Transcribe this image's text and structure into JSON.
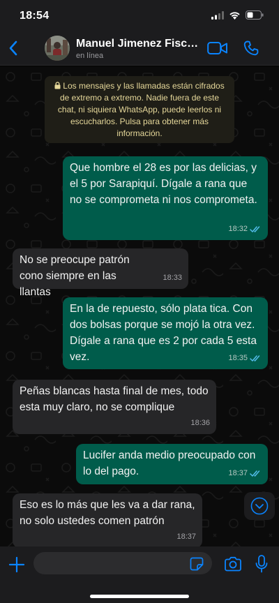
{
  "status_bar": {
    "time": "18:54"
  },
  "header": {
    "back_icon": "chevron-left-icon",
    "contact_name": "Manuel Jimenez Fisc…",
    "contact_status": "en línea",
    "video_icon": "video-camera-icon",
    "call_icon": "phone-icon"
  },
  "colors": {
    "accent": "#0a84ff",
    "outgoing_bubble": "#005c4b",
    "incoming_bubble": "#262628",
    "notice_bg": "#1f1e17",
    "notice_text": "#e6d89a"
  },
  "encryption_notice": "Los mensajes y las llamadas están cifrados de extremo a extremo. Nadie fuera de este chat, ni siquiera WhatsApp, puede leerlos ni escucharlos. Pulsa para obtener más información.",
  "messages": [
    {
      "direction": "out",
      "text": "Que hombre el 28 es por las delicias, y el 5 por Sarapiquí. Dígale a rana que no se comprometa ni nos comprometa.",
      "time": "18:32",
      "read": true
    },
    {
      "direction": "in",
      "text": "No se preocupe patrón cono siempre en las llantas",
      "time": "18:33"
    },
    {
      "direction": "out",
      "text": "En la de repuesto, sólo plata tica. Con dos bolsas porque se mojó la otra vez. Dígale a rana que es 2 por cada 5 esta vez.",
      "time": "18:35",
      "read": true
    },
    {
      "direction": "in",
      "text": "Peñas blancas hasta final de mes, todo esta muy claro, no se complique",
      "time": "18:36"
    },
    {
      "direction": "out",
      "text": "Lucifer anda medio preocupado con lo del pago.",
      "time": "18:37",
      "read": true
    },
    {
      "direction": "in",
      "text": "Eso es lo más que les va a dar rana, no solo ustedes comen patrón",
      "time": "18:37"
    }
  ],
  "composer": {
    "input_value": "",
    "attach_icon": "plus-icon",
    "sticker_icon": "sticker-icon",
    "camera_icon": "camera-icon",
    "mic_icon": "microphone-icon"
  }
}
